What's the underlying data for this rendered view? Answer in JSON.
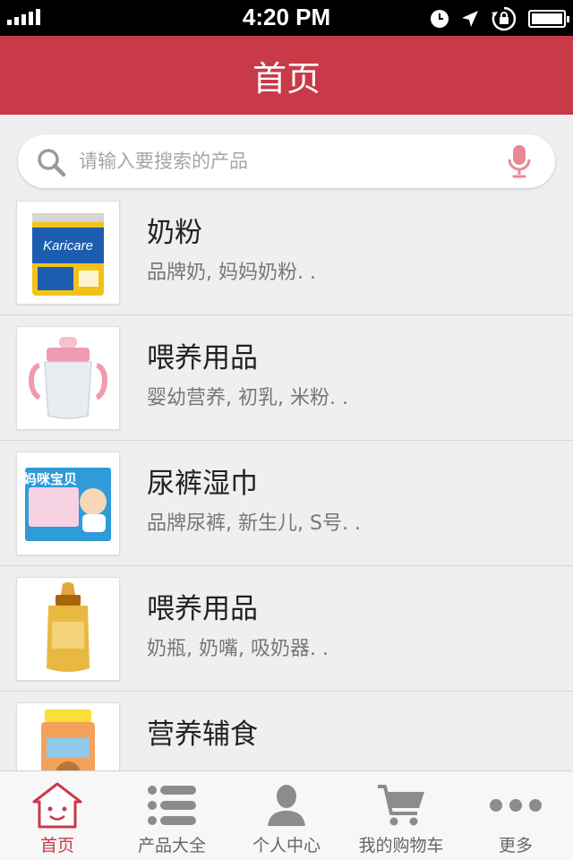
{
  "status_bar": {
    "time": "4:20 PM",
    "battery_level": 1.0
  },
  "nav": {
    "title": "首页"
  },
  "search": {
    "placeholder": "请输入要搜索的产品",
    "value": ""
  },
  "products": [
    {
      "title": "奶粉",
      "subtitle": "品牌奶, 妈妈奶粉. .",
      "thumb_label": "Karicare"
    },
    {
      "title": "喂养用品",
      "subtitle": "婴幼营养, 初乳, 米粉. .",
      "thumb_label": ""
    },
    {
      "title": "尿裤湿巾",
      "subtitle": "品牌尿裤, 新生儿, S号. .",
      "thumb_label": "妈咪宝贝"
    },
    {
      "title": "喂养用品",
      "subtitle": "奶瓶, 奶嘴, 吸奶器. .",
      "thumb_label": ""
    },
    {
      "title": "营养辅食",
      "subtitle": "",
      "thumb_label": ""
    }
  ],
  "tabs": [
    {
      "label": "首页",
      "icon": "home-icon"
    },
    {
      "label": "产品大全",
      "icon": "list-icon"
    },
    {
      "label": "个人中心",
      "icon": "person-icon"
    },
    {
      "label": "我的购物车",
      "icon": "cart-icon"
    },
    {
      "label": "更多",
      "icon": "more-icon"
    }
  ],
  "colors": {
    "accent": "#c93a48",
    "mic": "#e58a95",
    "tab_icon": "#8c8c8c"
  }
}
